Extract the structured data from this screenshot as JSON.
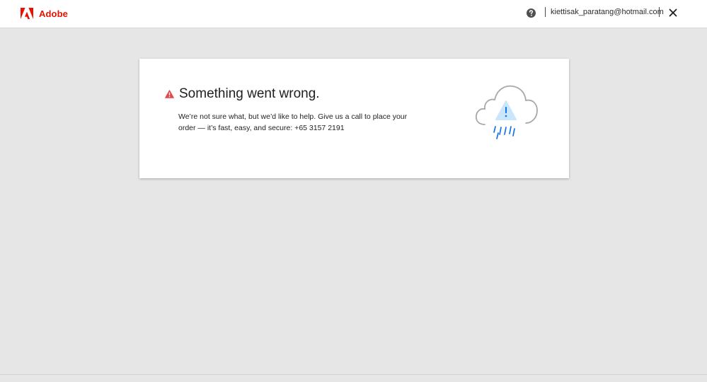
{
  "header": {
    "brand_name": "Adobe",
    "brand_logo_icon": "adobe-logo-icon",
    "help_icon": "question-circle-icon",
    "user_email": "kiettisak_paratang@hotmail.com",
    "close_icon": "close-icon"
  },
  "error_card": {
    "alert_icon": "warning-triangle-icon",
    "title": "Something went wrong.",
    "message": "We’re not sure what, but we’d like to help. Give us a call to place your order — it’s fast, easy, and secure: +65 3157 2191",
    "illustration_icon": "cloud-rain-warning-icon"
  },
  "colors": {
    "brand_red": "#eb1000",
    "page_background": "#e6e6e6",
    "card_background": "#ffffff",
    "illustration_blue": "#1473e6",
    "illustration_light_blue": "#c9e6fb",
    "cloud_outline": "#a8a8a8"
  }
}
